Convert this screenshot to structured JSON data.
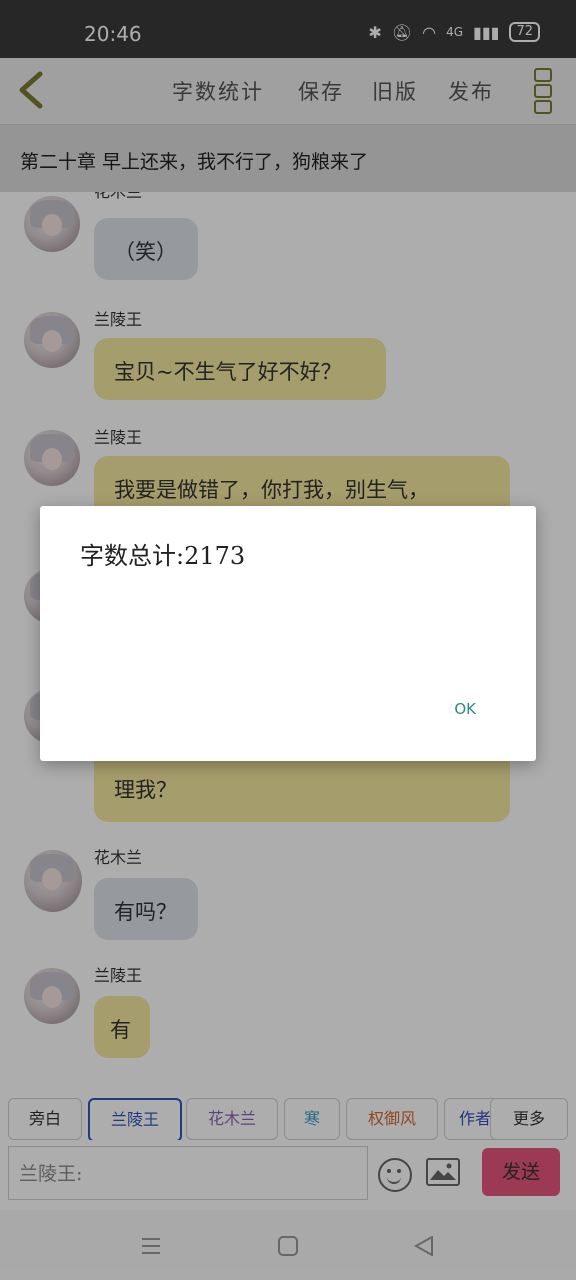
{
  "status_bar": {
    "time": "20:46",
    "network": "4G",
    "battery": "72"
  },
  "toolbar": {
    "menu": [
      "字数统计",
      "保存",
      "旧版",
      "发布"
    ]
  },
  "chapter": {
    "title": "第二十章  早上还来，我不行了，狗粮来了"
  },
  "messages": [
    {
      "name": "花木兰",
      "text": "（笑）",
      "style": "grey"
    },
    {
      "name": "兰陵王",
      "text": "宝贝~不生气了好不好？",
      "style": "yellow"
    },
    {
      "name": "兰陵王",
      "text": "我要是做错了，你打我，别生气，",
      "style": "yellow"
    },
    {
      "name": "",
      "text": "理我？",
      "style": "yellow"
    },
    {
      "name": "花木兰",
      "text": "有吗？",
      "style": "grey"
    },
    {
      "name": "兰陵王",
      "text": "有",
      "style": "yellow"
    }
  ],
  "speakers": [
    {
      "label": "旁白",
      "color": "#333333",
      "active": false
    },
    {
      "label": "兰陵王",
      "color": "#2f56b8",
      "active": true
    },
    {
      "label": "花木兰",
      "color": "#8a62b0",
      "active": false
    },
    {
      "label": "寒",
      "color": "#3a9bc5",
      "active": false
    },
    {
      "label": "权御风",
      "color": "#d2682f",
      "active": false
    },
    {
      "label": "作者",
      "color": "#2f4fbf",
      "active": false
    }
  ],
  "more_label": "更多",
  "input": {
    "placeholder": "兰陵王:"
  },
  "send_label": "发送",
  "dialog": {
    "message": "字数总计:2173",
    "ok": "OK"
  },
  "colors": {
    "accent": "#7a7b2d",
    "send": "#e6557c",
    "bubble_grey": "#dde3ea",
    "bubble_yellow": "#f5e79f",
    "dialog_ok": "#2c8a86"
  }
}
